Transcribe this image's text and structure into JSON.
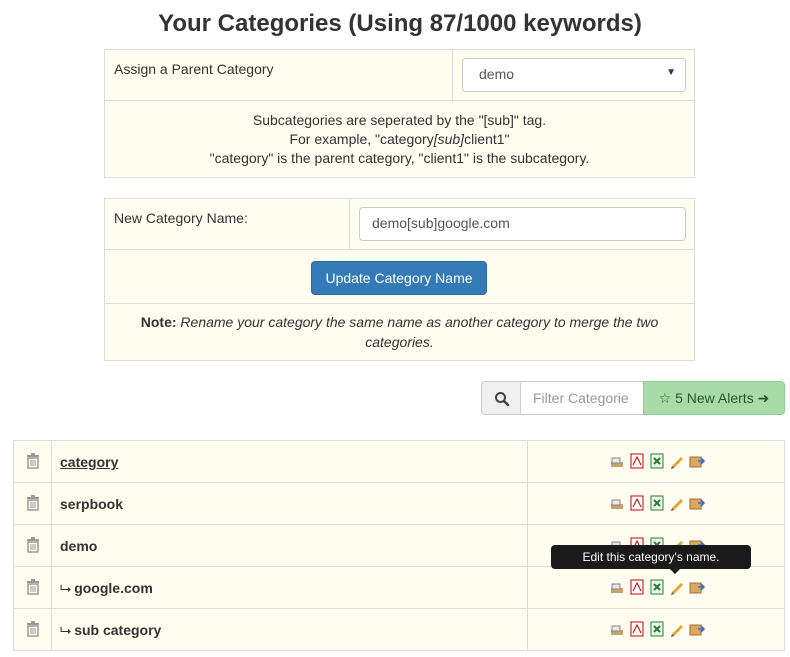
{
  "page": {
    "title": "Your Categories (Using 87/1000 keywords)"
  },
  "parent_form": {
    "label": "Assign a Parent Category",
    "selected_value": "demo",
    "info_lines": [
      "Subcategories are seperated by the \"[sub]\" tag.",
      "For example, \"category",
      "[sub]",
      "client1\"",
      "\"category\" is the parent category, \"client1\" is the subcategory."
    ]
  },
  "rename_form": {
    "label": "New Category Name:",
    "input_value": "demo[sub]google.com",
    "button_label": "Update Category Name",
    "note_label": "Note:",
    "note_text": "Rename your category the same name as another category to merge the two categories."
  },
  "filter": {
    "placeholder": "Filter Categorie",
    "alerts_label": "5 New Alerts"
  },
  "categories": [
    {
      "name": "category",
      "prefix": ""
    },
    {
      "name": "serpbook",
      "prefix": ""
    },
    {
      "name": "demo",
      "prefix": ""
    },
    {
      "name": "google.com",
      "prefix": "⮡"
    },
    {
      "name": "sub category",
      "prefix": "⮡"
    }
  ],
  "tooltip": {
    "text": "Edit this category's name."
  },
  "icons": [
    "trash-icon",
    "transfer-icon",
    "pdf-icon",
    "excel-icon",
    "pencil-icon",
    "export-icon",
    "search-icon",
    "star-icon",
    "arrow-right-icon"
  ],
  "colors": {
    "panel_bg": "#fffdf0",
    "primary": "#337ab7",
    "alert_green": "#a9dba9",
    "tooltip_bg": "#1a1a1a"
  }
}
